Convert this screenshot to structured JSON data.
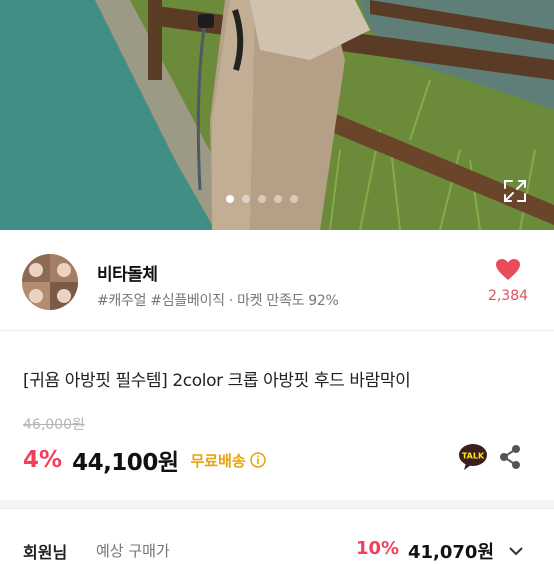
{
  "hero": {
    "total_images": 5,
    "active_index": 0
  },
  "seller": {
    "name": "비타돌체",
    "tags": "#캐주얼 #심플베이직 · 마켓 만족도 92%",
    "like_count": "2,384"
  },
  "product": {
    "title": "[귀욤 아방핏 필수템] 2color 크롭 아방핏 후드 바람막이",
    "original_price": "46,000원",
    "discount": "4%",
    "price": "44,100원",
    "shipping": "무료배송"
  },
  "member": {
    "label": "회원님",
    "sublabel": "예상 구매가",
    "discount": "10%",
    "price": "41,070원"
  },
  "colors": {
    "accent": "#f0405a",
    "shipping": "#e7a310",
    "kakao": "#3c1e1e"
  }
}
